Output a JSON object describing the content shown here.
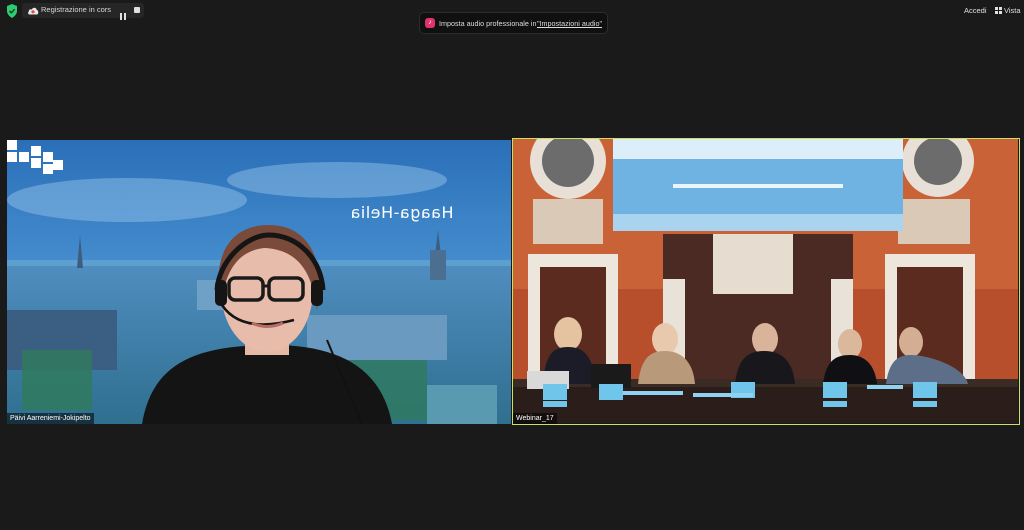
{
  "topbar": {
    "recording_label": "Registrazione in corso...",
    "toast_text": "Imposta audio professionale in",
    "toast_link": "\"Impostazioni audio\"",
    "signin_label": "Accedi",
    "view_label": "Vista"
  },
  "participants": [
    {
      "name": "Päivi Aarreniemi-Jokipelto",
      "background_brand": "Haaga-Helia"
    },
    {
      "name": "Webinar_17"
    }
  ],
  "colors": {
    "background": "#1a1a1a",
    "active_speaker_border": "#c9e265",
    "toast_icon": "#e0326e",
    "shield": "#2ecc71"
  },
  "icons": [
    "shield-icon",
    "cloud-recording-icon",
    "pause-icon",
    "stop-icon",
    "music-note-icon",
    "grid-view-icon"
  ]
}
